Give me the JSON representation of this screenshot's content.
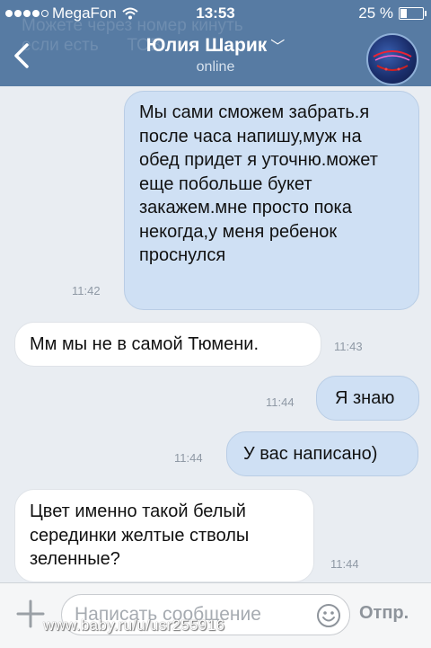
{
  "status_bar": {
    "carrier": "MegaFon",
    "time": "13:53",
    "battery": "25 %",
    "battery_level": 0.25
  },
  "nav": {
    "title": "Юлия Шарик",
    "subtitle": "online",
    "ghost_text": "Можете через номер кинуть\nесли есть      ТОВ      к"
  },
  "messages": [
    {
      "direction": "out",
      "text": "Мы сами сможем забрать.я после часа напишу,муж на обед придет я уточню.может еще побольше букет закажем.мне просто пока некогда,у меня ребенок проснулся",
      "time": "11:42"
    },
    {
      "direction": "in",
      "text": "Мм мы не в самой Тюмени.",
      "time": "11:43"
    },
    {
      "direction": "out",
      "text": "Я знаю",
      "time": "11:44"
    },
    {
      "direction": "out",
      "text": "У вас написано)",
      "time": "11:44"
    },
    {
      "direction": "in",
      "text": "Цвет именно такой белый серединки желтые стволы зеленные?",
      "time": "11:44"
    }
  ],
  "input": {
    "placeholder": "Написать сообщение",
    "value": "",
    "send_label": "Отпр."
  },
  "watermark": "www.baby.ru/u/usr255916",
  "colors": {
    "header": "#577ba3",
    "outgoing_bubble": "#cfe0f4",
    "incoming_bubble": "#ffffff",
    "background": "#e9edf2"
  }
}
